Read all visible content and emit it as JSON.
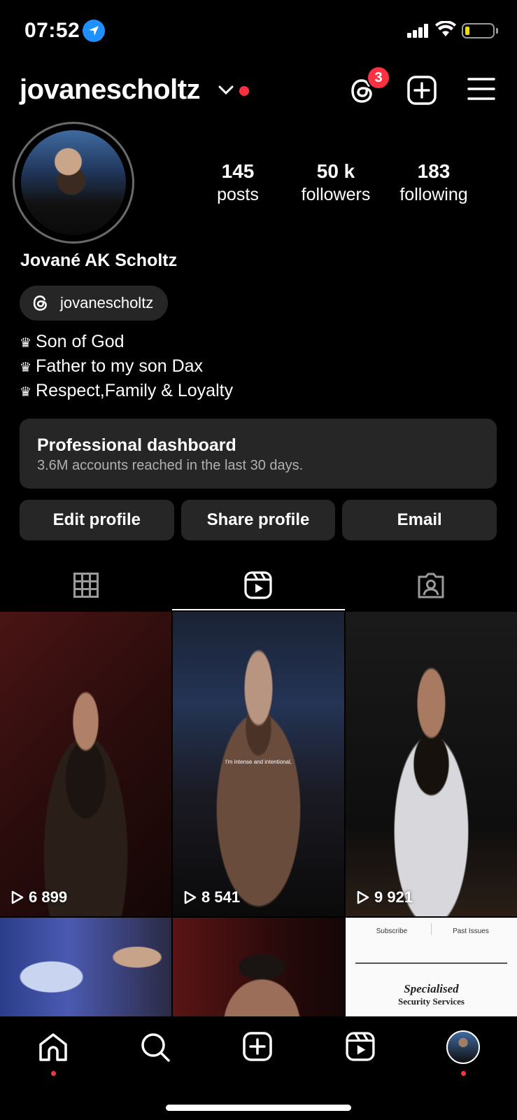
{
  "status_bar": {
    "time": "07:52"
  },
  "header": {
    "username": "jovanescholtz",
    "notification_count": "3"
  },
  "profile": {
    "stats": [
      {
        "value": "145",
        "label": "posts"
      },
      {
        "value": "50 k",
        "label": "followers"
      },
      {
        "value": "183",
        "label": "following"
      }
    ],
    "full_name": "Jované AK Scholtz",
    "threads_handle": "jovanescholtz",
    "bio": [
      {
        "icon": "♛",
        "text": "Son of God"
      },
      {
        "icon": "♛",
        "text": "Father to my son Dax"
      },
      {
        "icon": "♛",
        "text": "Respect,Family & Loyalty"
      }
    ]
  },
  "dashboard": {
    "title": "Professional dashboard",
    "subtitle": "3.6M accounts reached in the last 30 days."
  },
  "buttons": {
    "edit": "Edit profile",
    "share": "Share profile",
    "email": "Email"
  },
  "tabs": [
    "grid-icon",
    "reels-icon",
    "tagged-icon"
  ],
  "grid": {
    "reels": [
      {
        "views": "6 899"
      },
      {
        "views": "8 541",
        "caption": "I'm intense and intentional,"
      },
      {
        "views": "9 921"
      }
    ],
    "post6": {
      "subscribe": "Subscribe",
      "past_issues": "Past Issues",
      "title_line1": "Specialised",
      "title_line2": "Security Services"
    }
  },
  "colors": {
    "accent_red": "#ff3040",
    "surface": "#262626",
    "location_blue": "#1e90ff"
  }
}
